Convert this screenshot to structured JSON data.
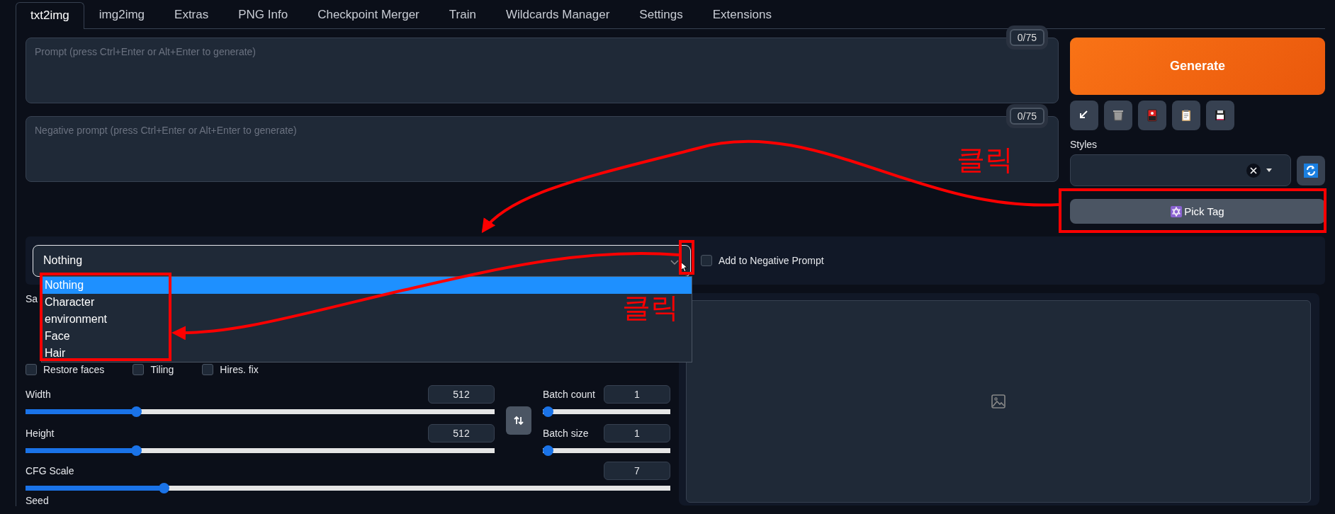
{
  "tabs": [
    {
      "label": "txt2img",
      "selected": true
    },
    {
      "label": "img2img",
      "selected": false
    },
    {
      "label": "Extras",
      "selected": false
    },
    {
      "label": "PNG Info",
      "selected": false
    },
    {
      "label": "Checkpoint Merger",
      "selected": false
    },
    {
      "label": "Train",
      "selected": false
    },
    {
      "label": "Wildcards Manager",
      "selected": false
    },
    {
      "label": "Settings",
      "selected": false
    },
    {
      "label": "Extensions",
      "selected": false
    }
  ],
  "prompt": {
    "placeholder": "Prompt (press Ctrl+Enter or Alt+Enter to generate)",
    "token_count": "0/75"
  },
  "negative_prompt": {
    "placeholder": "Negative prompt (press Ctrl+Enter or Alt+Enter to generate)",
    "token_count": "0/75"
  },
  "generate_button": "Generate",
  "styles": {
    "label": "Styles"
  },
  "pick_tag_button": "Pick Tag",
  "tag_picker": {
    "value": "Nothing",
    "expanded": true,
    "options": [
      {
        "label": "Nothing",
        "selected": true
      },
      {
        "label": "Character",
        "selected": false
      },
      {
        "label": "environment",
        "selected": false
      },
      {
        "label": "Face",
        "selected": false
      },
      {
        "label": "Hair",
        "selected": false
      }
    ],
    "add_to_negative": {
      "label": "Add to Negative Prompt",
      "checked": false
    }
  },
  "sampling_label": "Sa",
  "checkboxes": [
    {
      "label": "Restore faces",
      "checked": false
    },
    {
      "label": "Tiling",
      "checked": false
    },
    {
      "label": "Hires. fix",
      "checked": false
    }
  ],
  "size_sliders": [
    {
      "label": "Width",
      "value": "512",
      "level": 0.23
    },
    {
      "label": "Height",
      "value": "512",
      "level": 0.23
    }
  ],
  "batch_sliders": [
    {
      "label": "Batch count",
      "value": "1",
      "level": 0
    },
    {
      "label": "Batch size",
      "value": "1",
      "level": 0
    }
  ],
  "cfg_slider": {
    "label": "CFG Scale",
    "value": "7",
    "level": 0.21
  },
  "seed_label": "Seed",
  "annotations": [
    {
      "text": "클릭"
    },
    {
      "text": "클릭"
    }
  ]
}
